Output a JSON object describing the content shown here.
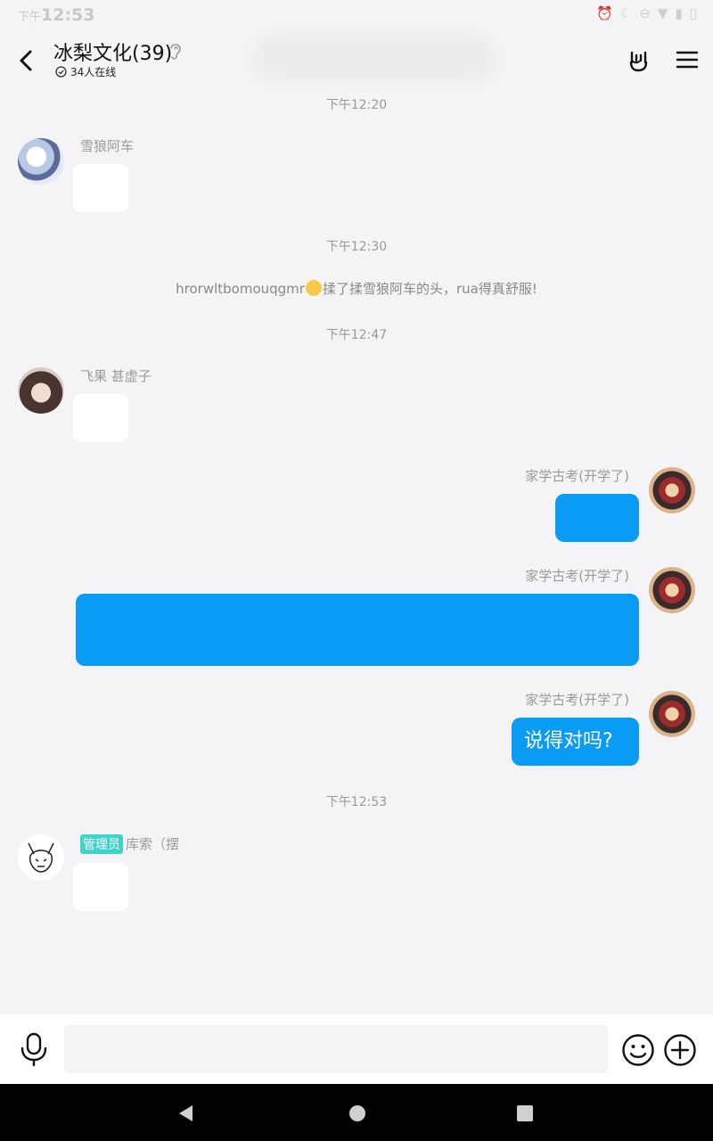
{
  "status_bar": {
    "time_prefix": "下午",
    "time": "12:53"
  },
  "header": {
    "title": "冰梨文化(39)",
    "online_count": "34人在线"
  },
  "messages": [
    {
      "type": "time",
      "text": "下午12:20"
    },
    {
      "type": "incoming",
      "sender": "雪狼阿车",
      "content": ""
    },
    {
      "type": "time",
      "text": "下午12:30"
    },
    {
      "type": "system",
      "text_before": "hrorwltbomouqgmr",
      "text_after": "揉了揉雪狼阿车的头，rua得真舒服!"
    },
    {
      "type": "time",
      "text": "下午12:47"
    },
    {
      "type": "incoming",
      "sender": "飞果 甚虚子",
      "content": ""
    },
    {
      "type": "outgoing",
      "sender": "家学古考(开学了)",
      "content": ""
    },
    {
      "type": "outgoing",
      "sender": "家学古考(开学了)",
      "content": ""
    },
    {
      "type": "outgoing",
      "sender": "家学古考(开学了)",
      "content": "说得对吗?"
    },
    {
      "type": "time",
      "text": "下午12:53"
    },
    {
      "type": "incoming",
      "badge": "管理员",
      "sender": "库索（摆",
      "content": ""
    }
  ],
  "input": {
    "placeholder": ""
  },
  "colors": {
    "bubble_me": "#0a9cf5",
    "admin_badge": "#3fd3c9",
    "background": "#f4f4f6"
  },
  "icons": [
    "back-arrow-icon",
    "ear-icon",
    "hand-gesture-icon",
    "menu-icon",
    "microphone-icon",
    "smiley-icon",
    "plus-icon"
  ]
}
